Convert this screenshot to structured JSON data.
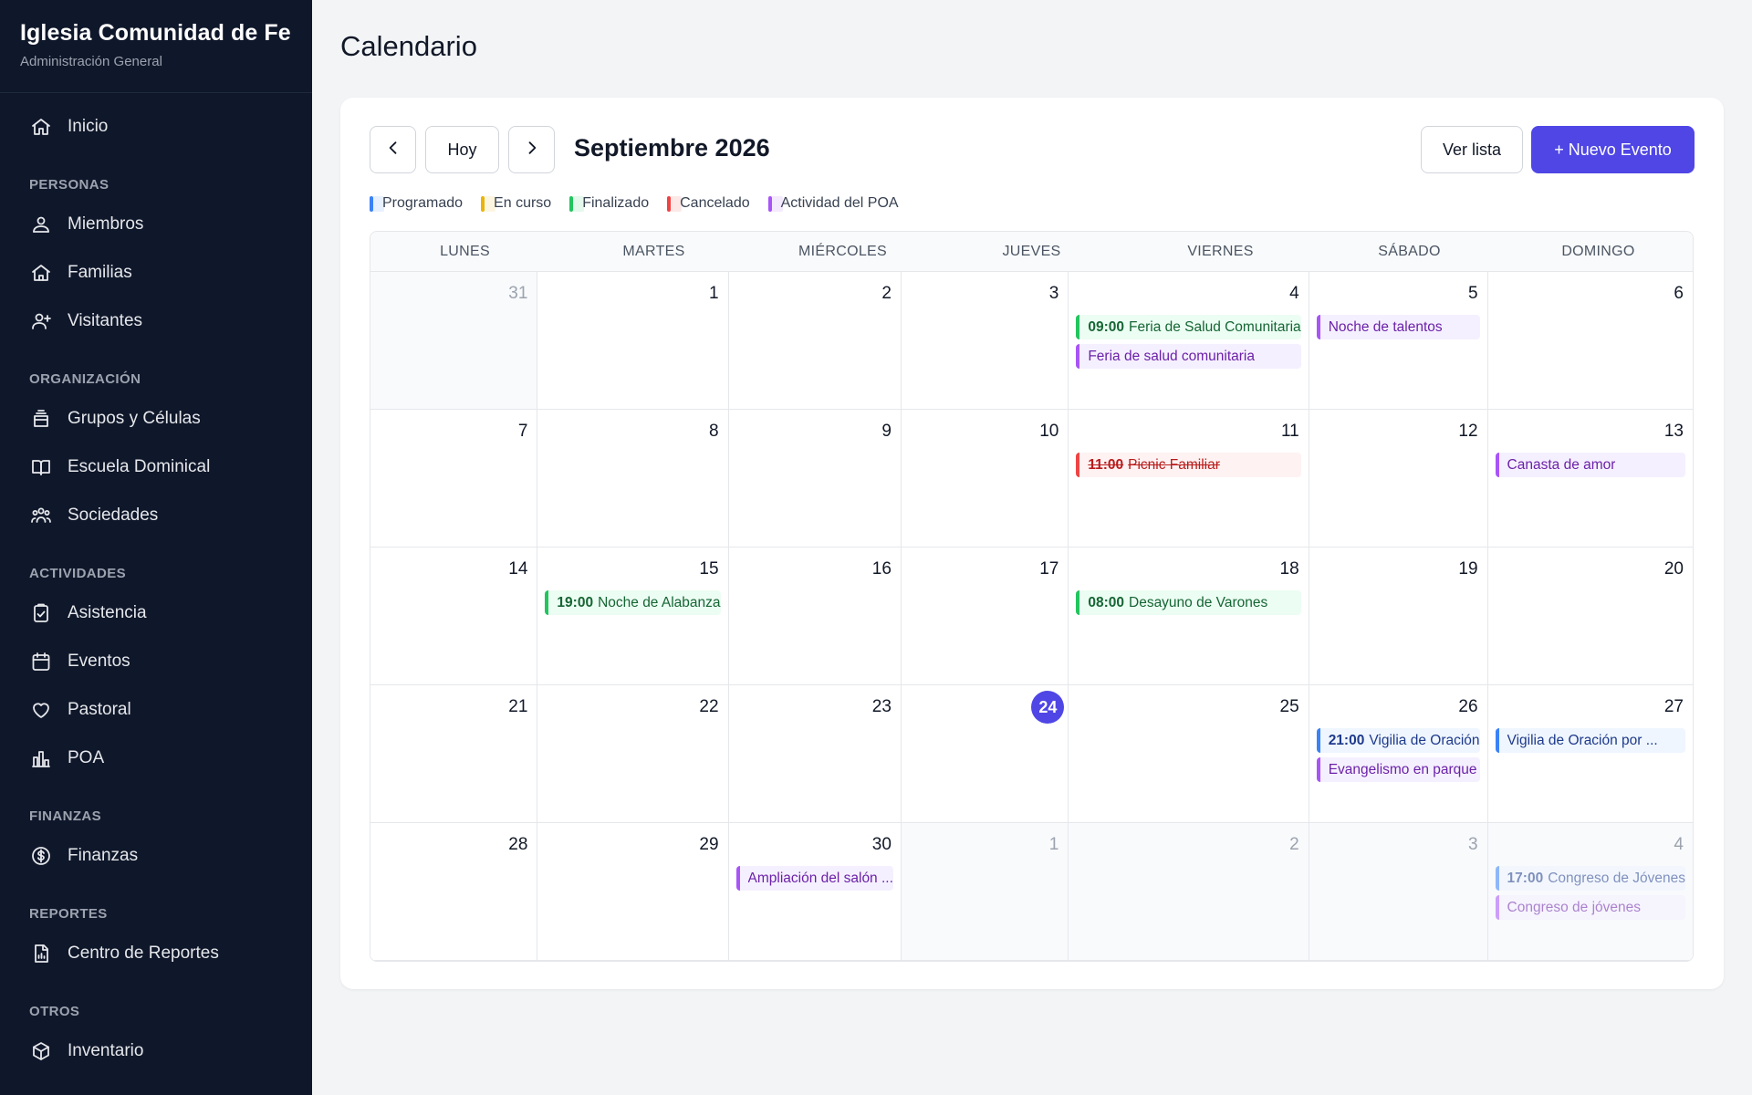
{
  "app": {
    "name": "Iglesia Comunidad de Fe",
    "subtitle": "Administración General"
  },
  "sidebar": {
    "home": {
      "label": "Inicio",
      "icon": "home-icon"
    },
    "sections": [
      {
        "title": "PERSONAS",
        "items": [
          {
            "label": "Miembros",
            "icon": "users-icon"
          },
          {
            "label": "Familias",
            "icon": "house-icon"
          },
          {
            "label": "Visitantes",
            "icon": "user-plus-icon"
          }
        ]
      },
      {
        "title": "ORGANIZACIÓN",
        "items": [
          {
            "label": "Grupos y Células",
            "icon": "layers-icon"
          },
          {
            "label": "Escuela Dominical",
            "icon": "book-icon"
          },
          {
            "label": "Sociedades",
            "icon": "group-icon"
          }
        ]
      },
      {
        "title": "ACTIVIDADES",
        "items": [
          {
            "label": "Asistencia",
            "icon": "clipboard-check-icon"
          },
          {
            "label": "Eventos",
            "icon": "calendar-icon"
          },
          {
            "label": "Pastoral",
            "icon": "heart-icon"
          },
          {
            "label": "POA",
            "icon": "bar-chart-icon"
          }
        ]
      },
      {
        "title": "FINANZAS",
        "items": [
          {
            "label": "Finanzas",
            "icon": "dollar-circle-icon"
          }
        ]
      },
      {
        "title": "REPORTES",
        "items": [
          {
            "label": "Centro de Reportes",
            "icon": "report-icon"
          }
        ]
      },
      {
        "title": "OTROS",
        "items": [
          {
            "label": "Inventario",
            "icon": "box-icon"
          }
        ]
      }
    ]
  },
  "page": {
    "title": "Calendario"
  },
  "toolbar": {
    "today_label": "Hoy",
    "month_title": "Septiembre 2026",
    "list_label": "Ver lista",
    "new_event_label": "+ Nuevo Evento"
  },
  "legend": [
    {
      "label": "Programado",
      "color": "#3b82f6"
    },
    {
      "label": "En curso",
      "color": "#eab308"
    },
    {
      "label": "Finalizado",
      "color": "#22c55e"
    },
    {
      "label": "Cancelado",
      "color": "#ef4444"
    },
    {
      "label": "Actividad del POA",
      "color": "#a855f7"
    }
  ],
  "calendar": {
    "weekdays": [
      "LUNES",
      "MARTES",
      "MIÉRCOLES",
      "JUEVES",
      "VIERNES",
      "SÁBADO",
      "DOMINGO"
    ],
    "today": 24,
    "days": [
      {
        "day": "31",
        "outside": true,
        "events": []
      },
      {
        "day": "1",
        "events": []
      },
      {
        "day": "2",
        "events": []
      },
      {
        "day": "3",
        "events": []
      },
      {
        "day": "4",
        "events": [
          {
            "time": "09:00",
            "title": "Feria de Salud Comunitaria",
            "status": "finalizado"
          },
          {
            "title": "Feria de salud comunitaria",
            "status": "poa"
          }
        ]
      },
      {
        "day": "5",
        "events": [
          {
            "title": "Noche de talentos",
            "status": "poa"
          }
        ]
      },
      {
        "day": "6",
        "events": []
      },
      {
        "day": "7",
        "events": []
      },
      {
        "day": "8",
        "events": []
      },
      {
        "day": "9",
        "events": []
      },
      {
        "day": "10",
        "events": []
      },
      {
        "day": "11",
        "events": [
          {
            "time": "11:00",
            "title": "Picnic Familiar",
            "status": "cancelado"
          }
        ]
      },
      {
        "day": "12",
        "events": []
      },
      {
        "day": "13",
        "events": [
          {
            "title": "Canasta de amor",
            "status": "poa"
          }
        ]
      },
      {
        "day": "14",
        "events": []
      },
      {
        "day": "15",
        "events": [
          {
            "time": "19:00",
            "title": "Noche de Alabanza",
            "status": "finalizado"
          }
        ]
      },
      {
        "day": "16",
        "events": []
      },
      {
        "day": "17",
        "events": []
      },
      {
        "day": "18",
        "events": [
          {
            "time": "08:00",
            "title": "Desayuno de Varones",
            "status": "finalizado"
          }
        ]
      },
      {
        "day": "19",
        "events": []
      },
      {
        "day": "20",
        "events": []
      },
      {
        "day": "21",
        "events": []
      },
      {
        "day": "22",
        "events": []
      },
      {
        "day": "23",
        "events": []
      },
      {
        "day": "24",
        "today": true,
        "events": []
      },
      {
        "day": "25",
        "events": []
      },
      {
        "day": "26",
        "events": [
          {
            "time": "21:00",
            "title": "Vigilia de Oración",
            "status": "programado"
          },
          {
            "title": "Evangelismo en parque",
            "status": "poa"
          }
        ]
      },
      {
        "day": "27",
        "events": [
          {
            "title": "Vigilia de Oración por ...",
            "status": "programado"
          }
        ]
      },
      {
        "day": "28",
        "events": []
      },
      {
        "day": "29",
        "events": []
      },
      {
        "day": "30",
        "events": [
          {
            "title": "Ampliación del salón ...",
            "status": "poa"
          }
        ]
      },
      {
        "day": "1",
        "outside": true,
        "events": []
      },
      {
        "day": "2",
        "outside": true,
        "events": []
      },
      {
        "day": "3",
        "outside": true,
        "events": []
      },
      {
        "day": "4",
        "outside": true,
        "events": [
          {
            "time": "17:00",
            "title": "Congreso de Jóvenes",
            "status": "programado"
          },
          {
            "title": "Congreso de jóvenes",
            "status": "poa"
          }
        ]
      }
    ]
  }
}
